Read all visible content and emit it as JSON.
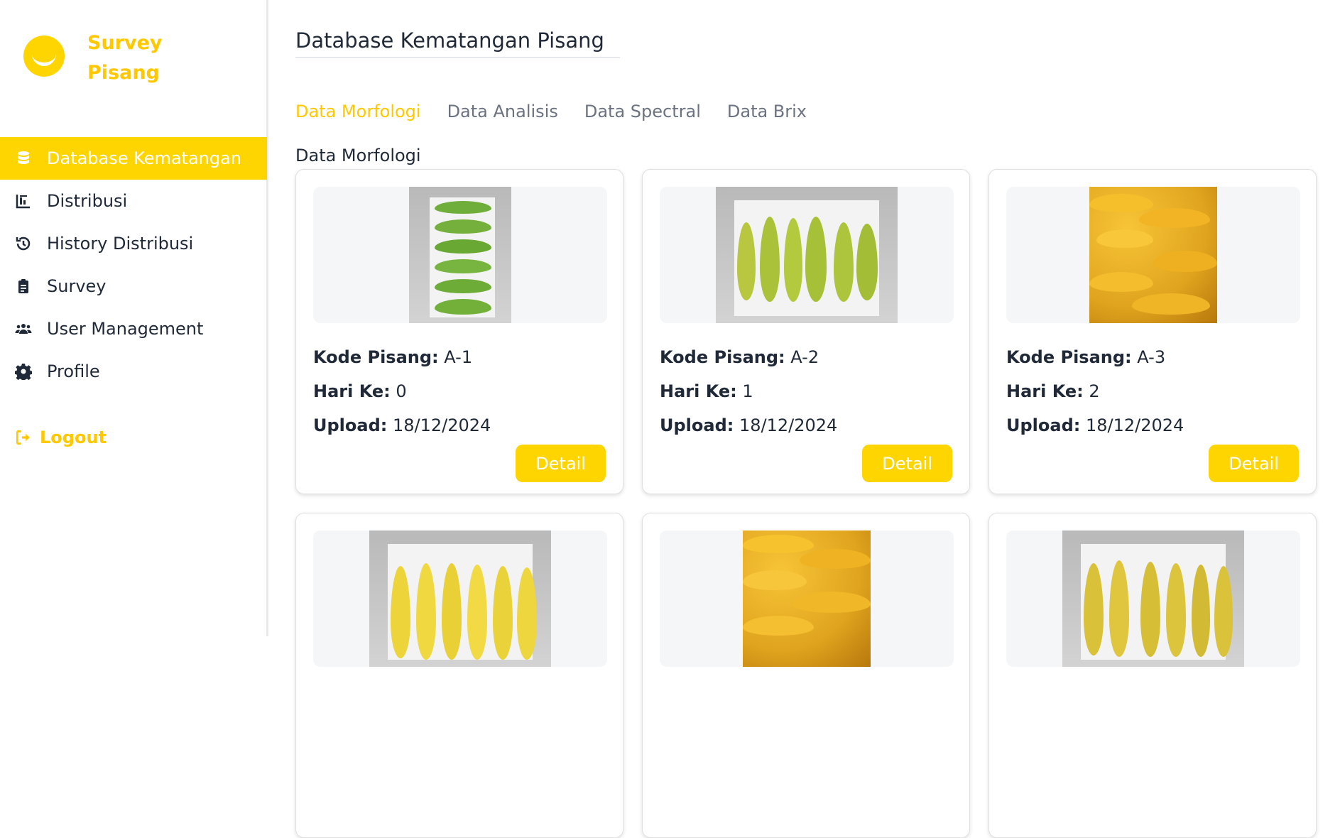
{
  "brand": {
    "name": "Survey Pisang"
  },
  "sidebar": {
    "items": [
      {
        "label": "Database Kematangan",
        "icon": "database-icon",
        "active": true
      },
      {
        "label": "Distribusi",
        "icon": "chart-bar-icon",
        "active": false
      },
      {
        "label": "History Distribusi",
        "icon": "history-icon",
        "active": false
      },
      {
        "label": "Survey",
        "icon": "clipboard-icon",
        "active": false
      },
      {
        "label": "User Management",
        "icon": "users-icon",
        "active": false
      },
      {
        "label": "Profile",
        "icon": "gear-icon",
        "active": false
      }
    ],
    "logout_label": "Logout"
  },
  "main": {
    "title": "Database Kematangan Pisang",
    "tabs": [
      {
        "label": "Data Morfologi",
        "active": true
      },
      {
        "label": "Data Analisis",
        "active": false
      },
      {
        "label": "Data Spectral",
        "active": false
      },
      {
        "label": "Data Brix",
        "active": false
      }
    ],
    "section_label": "Data Morfologi",
    "field_labels": {
      "kode": "Kode Pisang:",
      "hari": "Hari Ke:",
      "upload": "Upload:"
    },
    "detail_label": "Detail",
    "cards": [
      {
        "kode": "A-1",
        "hari": "0",
        "upload": "18/12/2024",
        "photo": "green-bananas-on-tray"
      },
      {
        "kode": "A-2",
        "hari": "1",
        "upload": "18/12/2024",
        "photo": "yellow-green-bananas-on-tray"
      },
      {
        "kode": "A-3",
        "hari": "2",
        "upload": "18/12/2024",
        "photo": "banana-bunch"
      },
      {
        "kode": "",
        "hari": "",
        "upload": "",
        "photo": "yellow-bananas-on-tray"
      },
      {
        "kode": "",
        "hari": "",
        "upload": "",
        "photo": "banana-bunch"
      },
      {
        "kode": "",
        "hari": "",
        "upload": "",
        "photo": "spotted-bananas-on-tray"
      }
    ]
  },
  "colors": {
    "accent": "#ffd500",
    "accent_text": "#ffc800",
    "text": "#1f2937",
    "muted": "#6b7280"
  }
}
